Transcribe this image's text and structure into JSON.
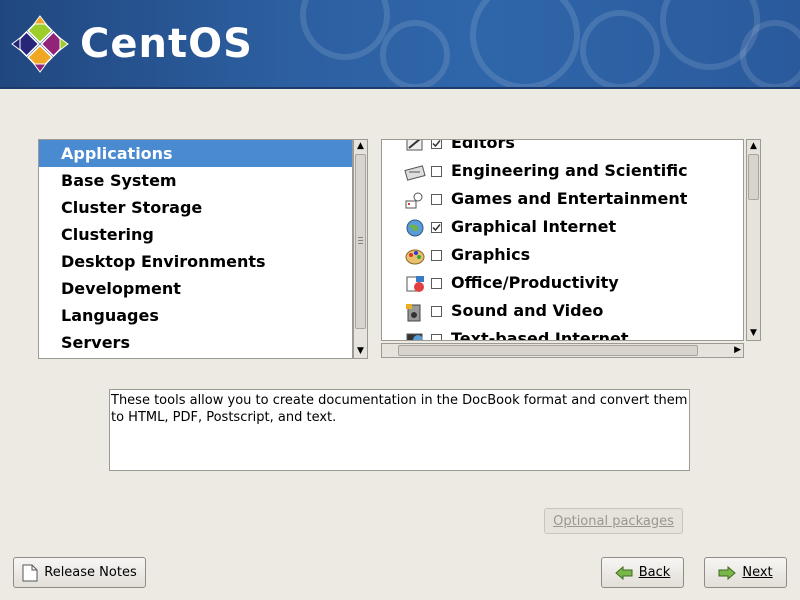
{
  "header": {
    "brand": "CentOS"
  },
  "categories": [
    {
      "label": "Applications",
      "selected": true
    },
    {
      "label": "Base System",
      "selected": false
    },
    {
      "label": "Cluster Storage",
      "selected": false
    },
    {
      "label": "Clustering",
      "selected": false
    },
    {
      "label": "Desktop Environments",
      "selected": false
    },
    {
      "label": "Development",
      "selected": false
    },
    {
      "label": "Languages",
      "selected": false
    },
    {
      "label": "Servers",
      "selected": false
    }
  ],
  "packages": [
    {
      "label": "Editors",
      "checked": true,
      "icon": "editor-icon"
    },
    {
      "label": "Engineering and Scientific",
      "checked": false,
      "icon": "engineering-icon"
    },
    {
      "label": "Games and Entertainment",
      "checked": false,
      "icon": "games-icon"
    },
    {
      "label": "Graphical Internet",
      "checked": true,
      "icon": "globe-icon"
    },
    {
      "label": "Graphics",
      "checked": false,
      "icon": "paint-icon"
    },
    {
      "label": "Office/Productivity",
      "checked": false,
      "icon": "office-icon"
    },
    {
      "label": "Sound and Video",
      "checked": false,
      "icon": "speaker-icon"
    },
    {
      "label": "Text-based Internet",
      "checked": false,
      "icon": "terminal-globe-icon"
    }
  ],
  "description": "These tools allow you to create documentation in the DocBook format and convert them to HTML, PDF, Postscript, and text.",
  "buttons": {
    "optional_packages": "Optional packages",
    "release_notes": "Release Notes",
    "back": "Back",
    "next": "Next"
  },
  "colors": {
    "selection": "#4a8ad0",
    "banner": "#2c5fa0"
  }
}
